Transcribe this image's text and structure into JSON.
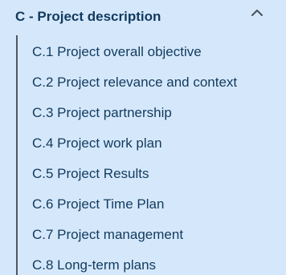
{
  "section": {
    "title": "C - Project description",
    "toggle_icon": "chevron-up-icon",
    "colors": {
      "background": "#d5e8fb",
      "text": "#123a5e",
      "tree_line": "#4f5861"
    },
    "items": [
      {
        "label": "C.1 Project overall objective"
      },
      {
        "label": "C.2 Project relevance and context"
      },
      {
        "label": "C.3 Project partnership"
      },
      {
        "label": "C.4 Project work plan"
      },
      {
        "label": "C.5 Project Results"
      },
      {
        "label": "C.6 Project Time Plan"
      },
      {
        "label": "C.7 Project management"
      },
      {
        "label": "C.8 Long-term plans"
      }
    ]
  }
}
